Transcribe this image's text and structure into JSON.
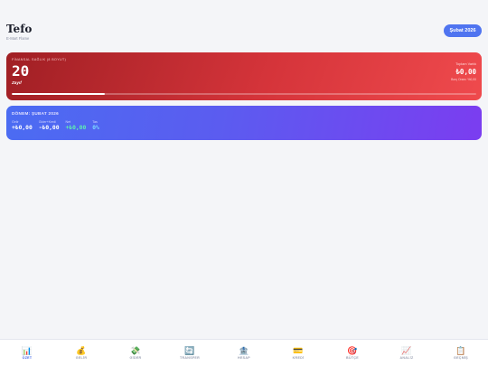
{
  "header": {
    "title": "Tefo",
    "subtitle": "E-Mart Flame",
    "period_button": "Şubat 2026"
  },
  "score_card": {
    "label": "FİNANSAL SAĞLIK (8 BOYUT)",
    "value": "20",
    "status": "Zayıf",
    "assets_label": "Toplam Varlık",
    "assets_value": "₺0,00",
    "assets_note": "Borç Oranı: %0,00",
    "progress": 0.2
  },
  "period_card": {
    "title": "DÖNEM: ŞUBAT 2026",
    "stats": [
      {
        "label": "Gelir",
        "value": "+₺0,00",
        "tone": "white"
      },
      {
        "label": "Gider+Kredi",
        "value": "-₺0,00",
        "tone": "white"
      },
      {
        "label": "Net",
        "value": "+₺0,00",
        "tone": "green"
      },
      {
        "label": "Tas",
        "value": "0%",
        "tone": "cyan"
      }
    ]
  },
  "nav": [
    {
      "icon": "📊",
      "icon_name": "chart-icon",
      "label": "ÖZET",
      "active": true
    },
    {
      "icon": "💰",
      "icon_name": "money-bag-icon",
      "label": "GELİR"
    },
    {
      "icon": "💸",
      "icon_name": "money-wings-icon",
      "label": "GİDER"
    },
    {
      "icon": "🔄",
      "icon_name": "transfer-icon",
      "label": "TRANSFER"
    },
    {
      "icon": "🏦",
      "icon_name": "bank-icon",
      "label": "HESAP"
    },
    {
      "icon": "💳",
      "icon_name": "credit-card-icon",
      "label": "KREDİ"
    },
    {
      "icon": "🎯",
      "icon_name": "target-icon",
      "label": "BÜTÇE"
    },
    {
      "icon": "📈",
      "icon_name": "trend-icon",
      "label": "ANALİZ"
    },
    {
      "icon": "📋",
      "icon_name": "clipboard-icon",
      "label": "GEÇMİŞ"
    }
  ],
  "colors": {
    "accent": "#4f74f0",
    "score_card": "#d5343a",
    "period_card_start": "#4b6cf2",
    "period_card_end": "#7b3df0",
    "positive": "#5ff2b0"
  }
}
